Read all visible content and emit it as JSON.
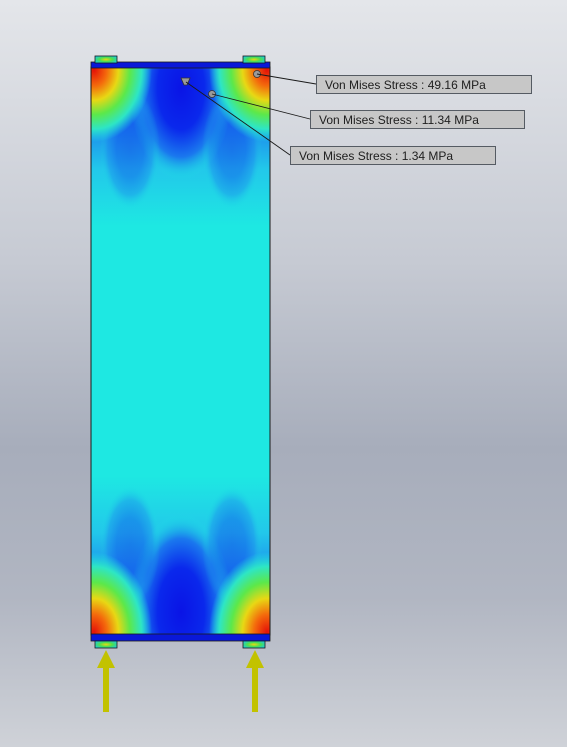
{
  "probes": [
    {
      "label": "Von Mises Stress",
      "separator": " : ",
      "value": "49.16 MPa"
    },
    {
      "label": "Von Mises Stress",
      "separator": " : ",
      "value": "11.34 MPa"
    },
    {
      "label": "Von Mises Stress",
      "separator": " : ",
      "value": "1.34 MPa"
    }
  ],
  "colors": {
    "low": "#0a14e6",
    "mid": "#1ee6e0",
    "high": "#e8140a",
    "load_arrow": "#c2c200",
    "frame": "#1a1a1a"
  }
}
